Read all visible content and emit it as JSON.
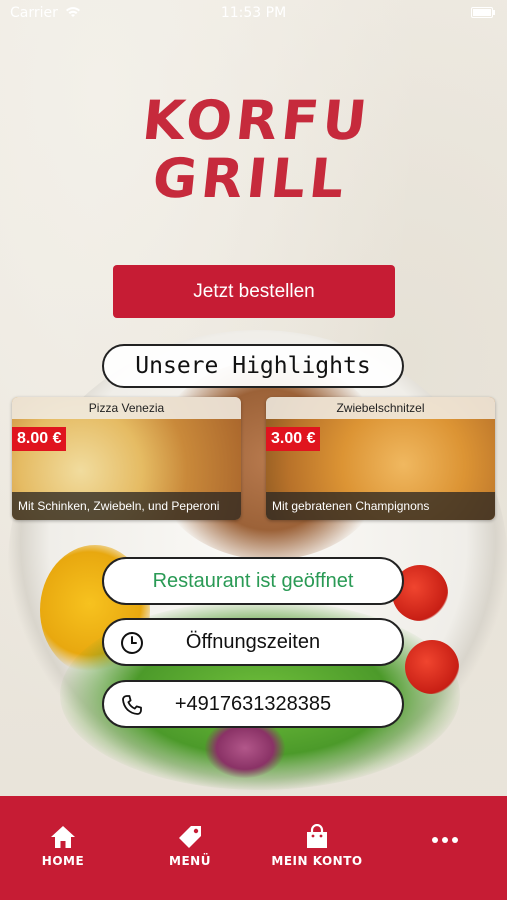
{
  "status_bar": {
    "carrier": "Carrier",
    "time": "11:53 PM"
  },
  "logo": {
    "line1": "KORFU",
    "line2": "GRILL"
  },
  "order_button": {
    "label": "Jetzt bestellen"
  },
  "highlights": {
    "title": "Unsere Highlights",
    "items": [
      {
        "name": "Pizza Venezia",
        "price": "8.00 €",
        "description": "Mit Schinken, Zwiebeln, und Peperoni"
      },
      {
        "name": "Zwiebelschnitzel",
        "price": "3.00 €",
        "description": "Mit gebratenen Champignons"
      }
    ]
  },
  "info": {
    "open_status": "Restaurant ist geöffnet",
    "hours_label": "Öffnungszeiten",
    "phone": "+4917631328385"
  },
  "tabbar": {
    "items": [
      {
        "label": "HOME",
        "icon": "home-icon"
      },
      {
        "label": "MENÜ",
        "icon": "tag-icon"
      },
      {
        "label": "MEIN KONTO",
        "icon": "shopping-bag-icon"
      },
      {
        "label": "",
        "icon": "more-icon"
      }
    ]
  },
  "colors": {
    "brand": "#c61c34",
    "open_status": "#2a9a55",
    "price_badge": "#e0141e"
  }
}
